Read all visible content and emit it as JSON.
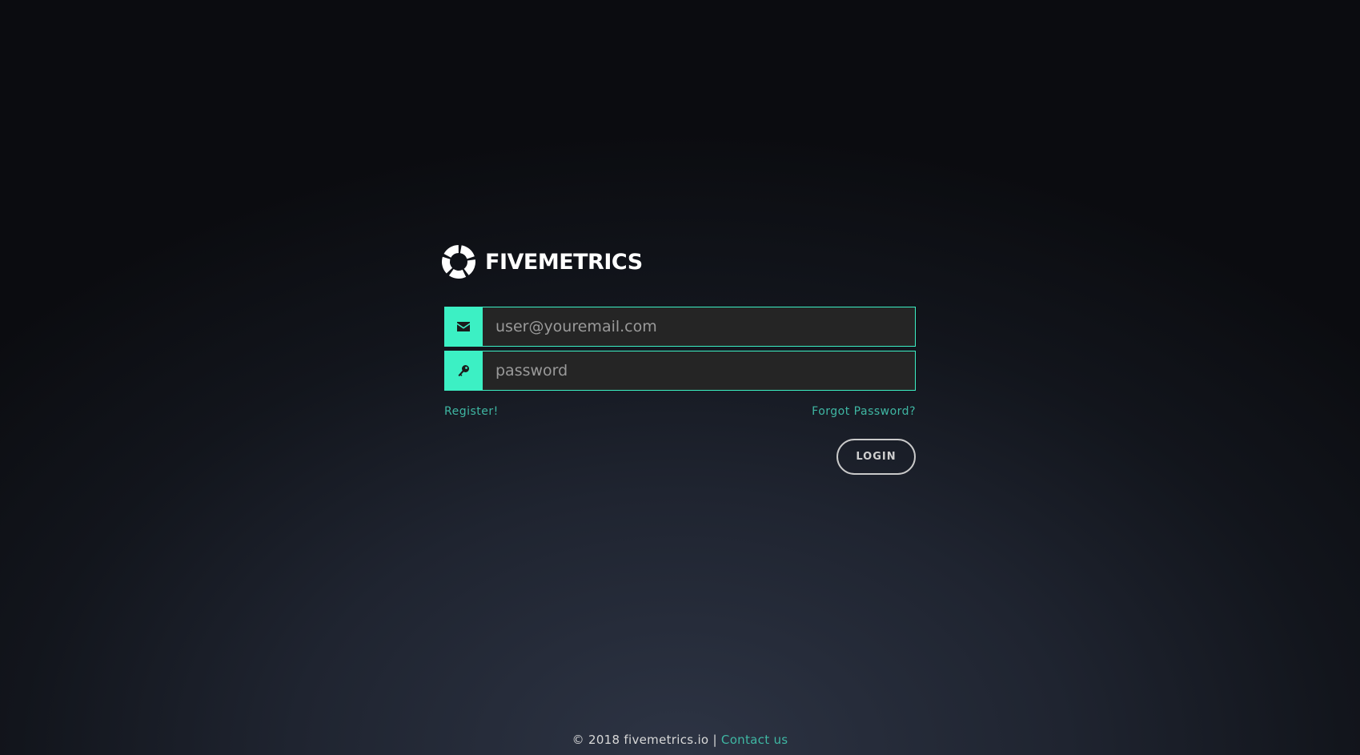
{
  "brand": {
    "name": "FIVEMETRICS",
    "logo_icon": "fivemetrics-ring-logo"
  },
  "login_form": {
    "email": {
      "icon": "envelope-icon",
      "placeholder": "user@youremail.com",
      "value": ""
    },
    "password": {
      "icon": "key-icon",
      "placeholder": "password",
      "value": ""
    },
    "register_link": "Register!",
    "forgot_password_link": "Forgot Password?",
    "login_button": "LOGIN"
  },
  "footer": {
    "copyright": "© 2018 fivemetrics.io",
    "separator": "|",
    "contact_link": "Contact us"
  },
  "colors": {
    "accent": "#3cf0c4",
    "link": "#3fb7a3",
    "input_background": "#252525",
    "page_background_dark": "#0b0c10",
    "page_background_light": "#2d3444"
  }
}
